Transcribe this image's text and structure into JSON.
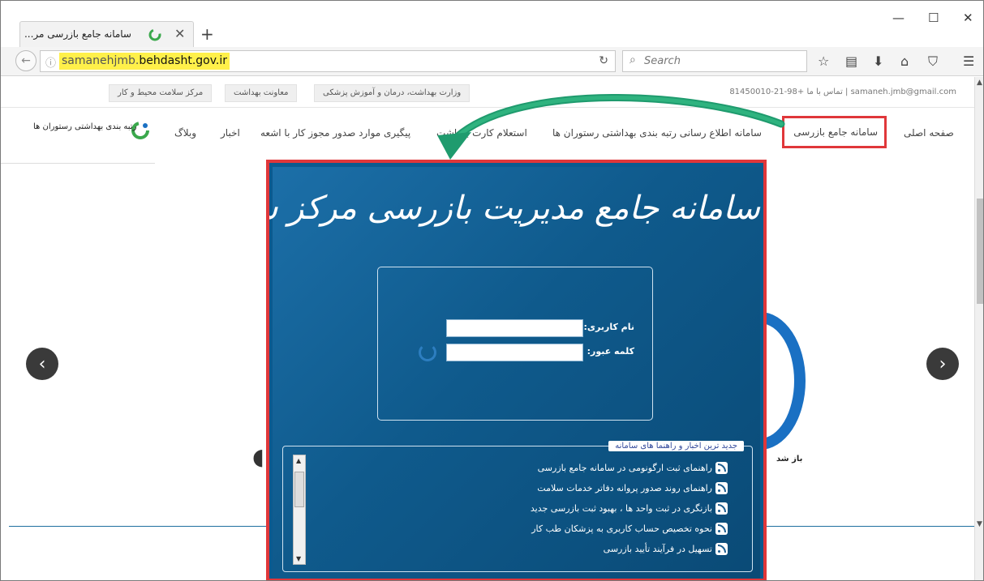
{
  "browser": {
    "tab_title": "سامانه جامع بازرسی مر...",
    "url_prefix": "samanehjmb.",
    "url_domain": "behdasht.gov.ir",
    "search_placeholder": "Search",
    "icons": [
      "bookmark-star-icon",
      "reader-icon",
      "download-icon",
      "home-icon",
      "pocket-icon",
      "menu-icon"
    ]
  },
  "topstrip": {
    "contact": "تماس با ما +98-21-81450010 | samaneh.jmb@gmail.com",
    "links": [
      "وزارت بهداشت، درمان و آموزش پزشکی",
      "معاونت بهداشت",
      "مرکز سلامت محیط و کار"
    ]
  },
  "menu": {
    "items": [
      "صفحه اصلی",
      "سامانه جامع بازرسی",
      "سامانه اطلاع رسانی رتبه بندی بهداشتی رستوران ها",
      "استعلام کارت بهداشت",
      "پیگیری موارد صدور مجوز کار با اشعه",
      "اخبار",
      "وبلاگ"
    ],
    "brand": "رتبه بندی بهداشتی رستوران ها"
  },
  "page": {
    "bg_partial_text": "باز شد"
  },
  "login": {
    "title": "سامانه جامع مدیریت بازرسی مرکز سلامت محیط و کار",
    "username_label": "نام کاربری:",
    "password_label": "کلمه عبور:"
  },
  "news": {
    "header": "جدید ترین اخبار و راهنما های سامانه",
    "items": [
      "راهنمای ثبت ارگونومی در سامانه جامع بازرسی",
      "راهنمای روند صدور پروانه دفاتر خدمات سلامت",
      "بازنگری در ثبت واحد ها ، بهبود ثبت بازرسی جدید",
      "نحوه تخصیص حساب کاربری به پزشکان طب کار",
      "تسهیل در فرآیند تأیید بازرسی"
    ]
  },
  "colors": {
    "highlight_red": "#e0373a",
    "annotation_green": "#1f9b6e",
    "url_highlight": "#fff04a",
    "login_blue": "#0f5a8c"
  }
}
